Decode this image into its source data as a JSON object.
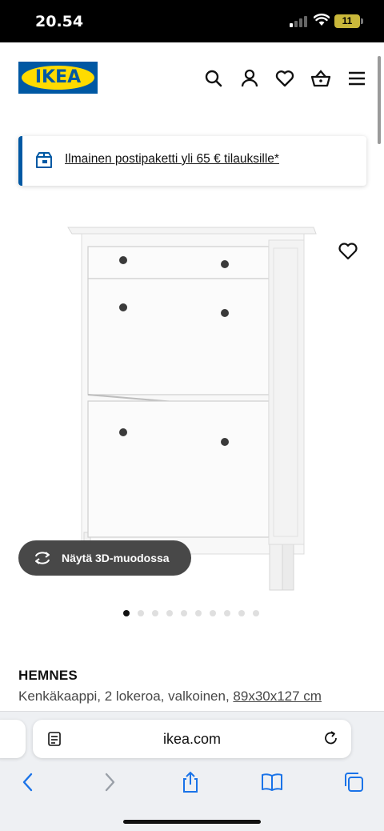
{
  "status": {
    "time": "20.54",
    "battery": "11"
  },
  "header": {
    "logo_text": "IKEA",
    "icons": [
      "search-icon",
      "account-icon",
      "wishlist-icon",
      "basket-icon",
      "menu-icon"
    ]
  },
  "banner": {
    "text": "Ilmainen postipaketti yli 65 € tilauksille*",
    "icon": "delivery-box-icon"
  },
  "gallery": {
    "view3d_label": "Näytä 3D-muodossa",
    "image_count": 10,
    "active_index": 0
  },
  "product": {
    "name": "HEMNES",
    "description": "Kenkäkaappi, 2 lokeroa, valkoinen, ",
    "dimensions": "89x30x127 cm"
  },
  "browser": {
    "url": "ikea.com"
  },
  "colors": {
    "ikea_blue": "#0058a3",
    "ikea_yellow": "#ffdb00",
    "button_dark": "#484848"
  }
}
